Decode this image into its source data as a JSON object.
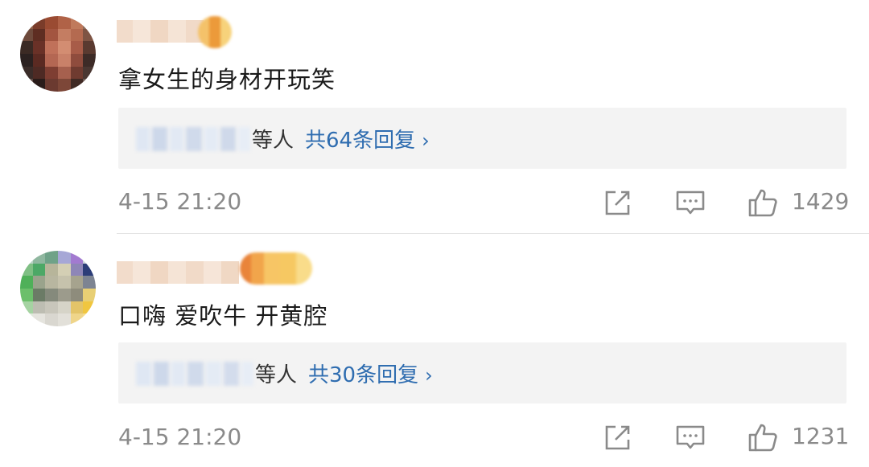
{
  "comments": [
    {
      "text": "拿女生的身材开玩笑",
      "replies": {
        "label": "等人",
        "count_text": "共64条回复",
        "chevron": "›"
      },
      "timestamp": "4-15 21:20",
      "likes": "1429"
    },
    {
      "text": "口嗨 爱吹牛 开黄腔",
      "replies": {
        "label": "等人",
        "count_text": "共30条回复",
        "chevron": "›"
      },
      "timestamp": "4-15 21:20",
      "likes": "1231"
    }
  ],
  "icons": {
    "share": "share-icon",
    "reply": "comment-icon",
    "like": "thumbs-up-icon"
  },
  "colors": {
    "link": "#2f6db0",
    "meta": "#8a8a8a",
    "reply_bg": "#f3f3f3"
  }
}
